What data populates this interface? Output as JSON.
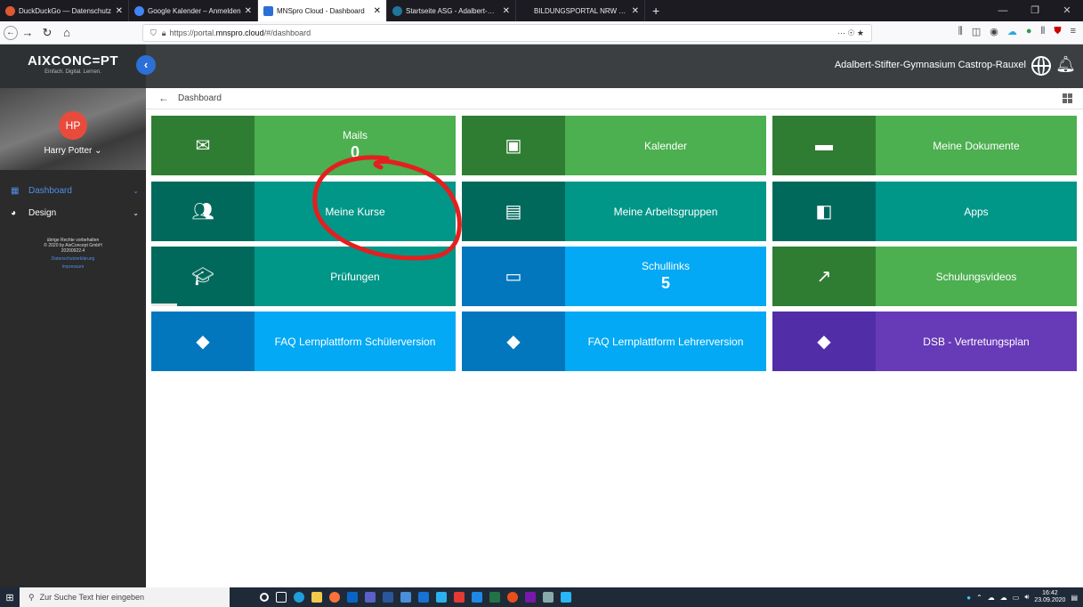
{
  "browser": {
    "tabs": [
      {
        "label": "DuckDuckGo — Datenschutz",
        "favicon_color": "#de5833",
        "active": false
      },
      {
        "label": "Google Kalender – Anmelden",
        "favicon_color": "#4285f4",
        "active": false
      },
      {
        "label": "MNSpro Cloud - Dashboard",
        "favicon_color": "#2c6fd6",
        "active": true
      },
      {
        "label": "Startseite ASG - Adalbert-Stifter",
        "favicon_color": "#21759b",
        "active": false
      },
      {
        "label": "BILDUNGSPORTAL NRW - Anm",
        "favicon_color": "#1c1b22",
        "active": false
      }
    ],
    "new_tab": "+",
    "url_prefix": "https://portal.",
    "url_domain": "mnspro.cloud",
    "url_suffix": "/#/dashboard",
    "url_more": "··· ☉ ★"
  },
  "app": {
    "logo_text": "AIXCONC=PT",
    "logo_tagline": "Einfach. Digital. Lernen.",
    "school_name": "Adalbert-Stifter-Gymnasium Castrop-Rauxel"
  },
  "sidebar": {
    "avatar_initials": "HP",
    "user_name": "Harry Potter",
    "items": [
      {
        "label": "Dashboard",
        "color": "#4f8fe6"
      },
      {
        "label": "Design",
        "color": "#ffffff"
      }
    ],
    "footer_lines": [
      "übrige Rechte vorbehalten",
      "© 2020 by AixConcept GmbH",
      "20200922.4"
    ],
    "footer_links": [
      "Datenschutzerklärung",
      "Impressum"
    ]
  },
  "breadcrumb": {
    "label": "Dashboard"
  },
  "tiles": [
    {
      "label": "Mails",
      "count": "0",
      "icon": "envelope-icon",
      "icon_bg": "#2f7d32",
      "bg": "#4caf50"
    },
    {
      "label": "Kalender",
      "count": "",
      "icon": "calendar-icon",
      "icon_bg": "#2f7d32",
      "bg": "#4caf50"
    },
    {
      "label": "Meine Dokumente",
      "count": "",
      "icon": "folder-icon",
      "icon_bg": "#2f7d32",
      "bg": "#4caf50"
    },
    {
      "label": "Meine Kurse",
      "count": "",
      "icon": "people-icon",
      "icon_bg": "#00695c",
      "bg": "#009688"
    },
    {
      "label": "Meine Arbeitsgruppen",
      "count": "",
      "icon": "card-icon",
      "icon_bg": "#00695c",
      "bg": "#009688"
    },
    {
      "label": "Apps",
      "count": "",
      "icon": "apps-icon",
      "icon_bg": "#00695c",
      "bg": "#009688"
    },
    {
      "label": "Prüfungen",
      "count": "",
      "icon": "graduation-cap-icon",
      "icon_bg": "#00695c",
      "bg": "#009688"
    },
    {
      "label": "Schullinks",
      "count": "5",
      "icon": "window-icon",
      "icon_bg": "#0277bd",
      "bg": "#03a9f4"
    },
    {
      "label": "Schulungsvideos",
      "count": "",
      "icon": "external-link-icon",
      "icon_bg": "#2f7d32",
      "bg": "#4caf50"
    },
    {
      "label": "FAQ Lernplattform Schülerversion",
      "count": "",
      "icon": "direction-icon",
      "icon_bg": "#0277bd",
      "bg": "#03a9f4"
    },
    {
      "label": "FAQ Lernplattform Lehrerversion",
      "count": "",
      "icon": "direction-icon",
      "icon_bg": "#0277bd",
      "bg": "#03a9f4"
    },
    {
      "label": "DSB - Vertretungsplan",
      "count": "",
      "icon": "direction-icon",
      "icon_bg": "#512da8",
      "bg": "#673ab7"
    }
  ],
  "taskbar": {
    "search_placeholder": "Zur Suche Text hier eingeben",
    "time": "16:42",
    "date": "23.09.2020"
  }
}
